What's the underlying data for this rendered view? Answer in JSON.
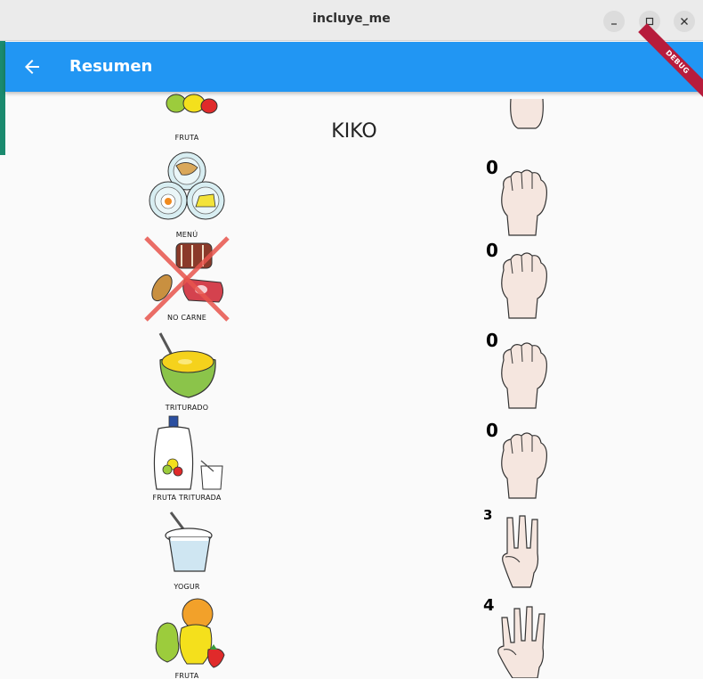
{
  "window": {
    "title": "incluye_me"
  },
  "appbar": {
    "title": "Resumen",
    "debug_banner": "DEBUG"
  },
  "section": {
    "title": "KIKO"
  },
  "partial_top": {
    "label": "FRUTA"
  },
  "items": [
    {
      "label": "MENÚ",
      "count": "0",
      "icon": "menu-plates-icon",
      "hand": "fist-hand-icon"
    },
    {
      "label": "NO CARNE",
      "count": "0",
      "icon": "no-meat-icon",
      "hand": "fist-hand-icon"
    },
    {
      "label": "TRITURADO",
      "count": "0",
      "icon": "puree-bowl-icon",
      "hand": "fist-hand-icon"
    },
    {
      "label": "FRUTA TRITURADA",
      "count": "0",
      "icon": "fruit-pouch-icon",
      "hand": "fist-hand-icon"
    },
    {
      "label": "YOGUR",
      "count": "3",
      "icon": "yogurt-icon",
      "hand": "three-fingers-hand-icon"
    },
    {
      "label": "FRUTA",
      "count": "4",
      "icon": "fruit-icon",
      "hand": "four-fingers-hand-icon"
    }
  ],
  "colors": {
    "appbar": "#2196f3",
    "debug": "#b71c3c",
    "skin": "#f5e6df"
  }
}
